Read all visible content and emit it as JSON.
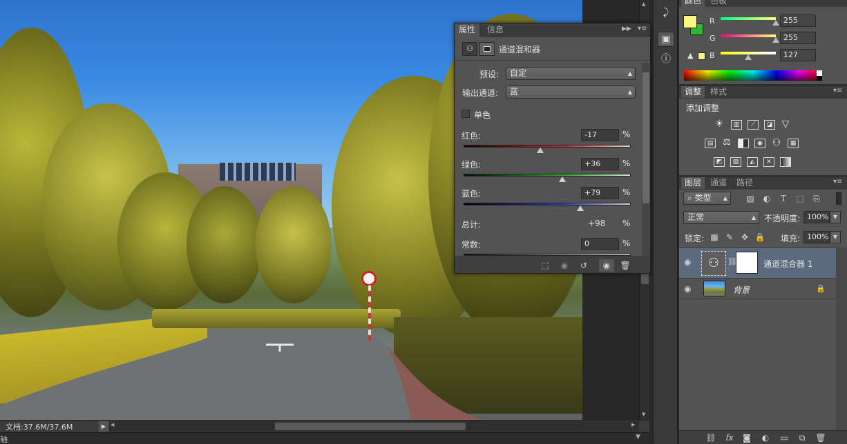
{
  "status_bar": {
    "doc_size": "文档:37.6M/37.6M",
    "bottom_label": "轴"
  },
  "properties_panel": {
    "tabs": [
      "属性",
      "信息"
    ],
    "title": "通道混和器",
    "preset_label": "预设:",
    "preset_value": "自定",
    "output_channel_label": "输出通道:",
    "output_channel_value": "蓝",
    "monochrome_label": "单色",
    "channels": [
      {
        "label": "红色:",
        "value": "-17",
        "numeric": -17,
        "color": "#c43131"
      },
      {
        "label": "绿色:",
        "value": "+36",
        "numeric": 36,
        "color": "#33b033"
      },
      {
        "label": "蓝色:",
        "value": "+79",
        "numeric": 79,
        "color": "#3a3ad6"
      }
    ],
    "percent_symbol": "%",
    "total_label": "总计:",
    "total_value": "+98",
    "constant_label": "常数:",
    "constant_value": "0"
  },
  "color_panel": {
    "tabs": [
      "颜色",
      "色板"
    ],
    "fg_color": "#f7f77f",
    "bg_color": "#2fb52f",
    "channels": [
      {
        "label": "R",
        "value": "255",
        "fraction": 1.0
      },
      {
        "label": "G",
        "value": "255",
        "fraction": 1.0
      },
      {
        "label": "B",
        "value": "127",
        "fraction": 0.5
      }
    ]
  },
  "adjustments_panel": {
    "tabs": [
      "调整",
      "样式"
    ],
    "heading": "添加调整",
    "icons": [
      [
        "brightness-contrast",
        "levels",
        "curves",
        "exposure",
        "vibrance"
      ],
      [
        "hue-saturation",
        "color-balance",
        "black-white",
        "photo-filter",
        "channel-mixer",
        "color-lookup"
      ],
      [
        "invert",
        "posterize",
        "threshold",
        "selective-color",
        "gradient-map"
      ]
    ]
  },
  "layers_panel": {
    "tabs": [
      "图层",
      "通道",
      "路径"
    ],
    "filter_kind": "类型",
    "blend_mode": "正常",
    "opacity_label": "不透明度:",
    "opacity_value": "100%",
    "lock_label": "锁定:",
    "fill_label": "填充:",
    "fill_value": "100%",
    "layers": [
      {
        "name": "通道混合器 1",
        "type": "adjustment",
        "selected": true
      },
      {
        "name": "背景",
        "type": "image",
        "selected": false,
        "locked": true
      }
    ]
  }
}
